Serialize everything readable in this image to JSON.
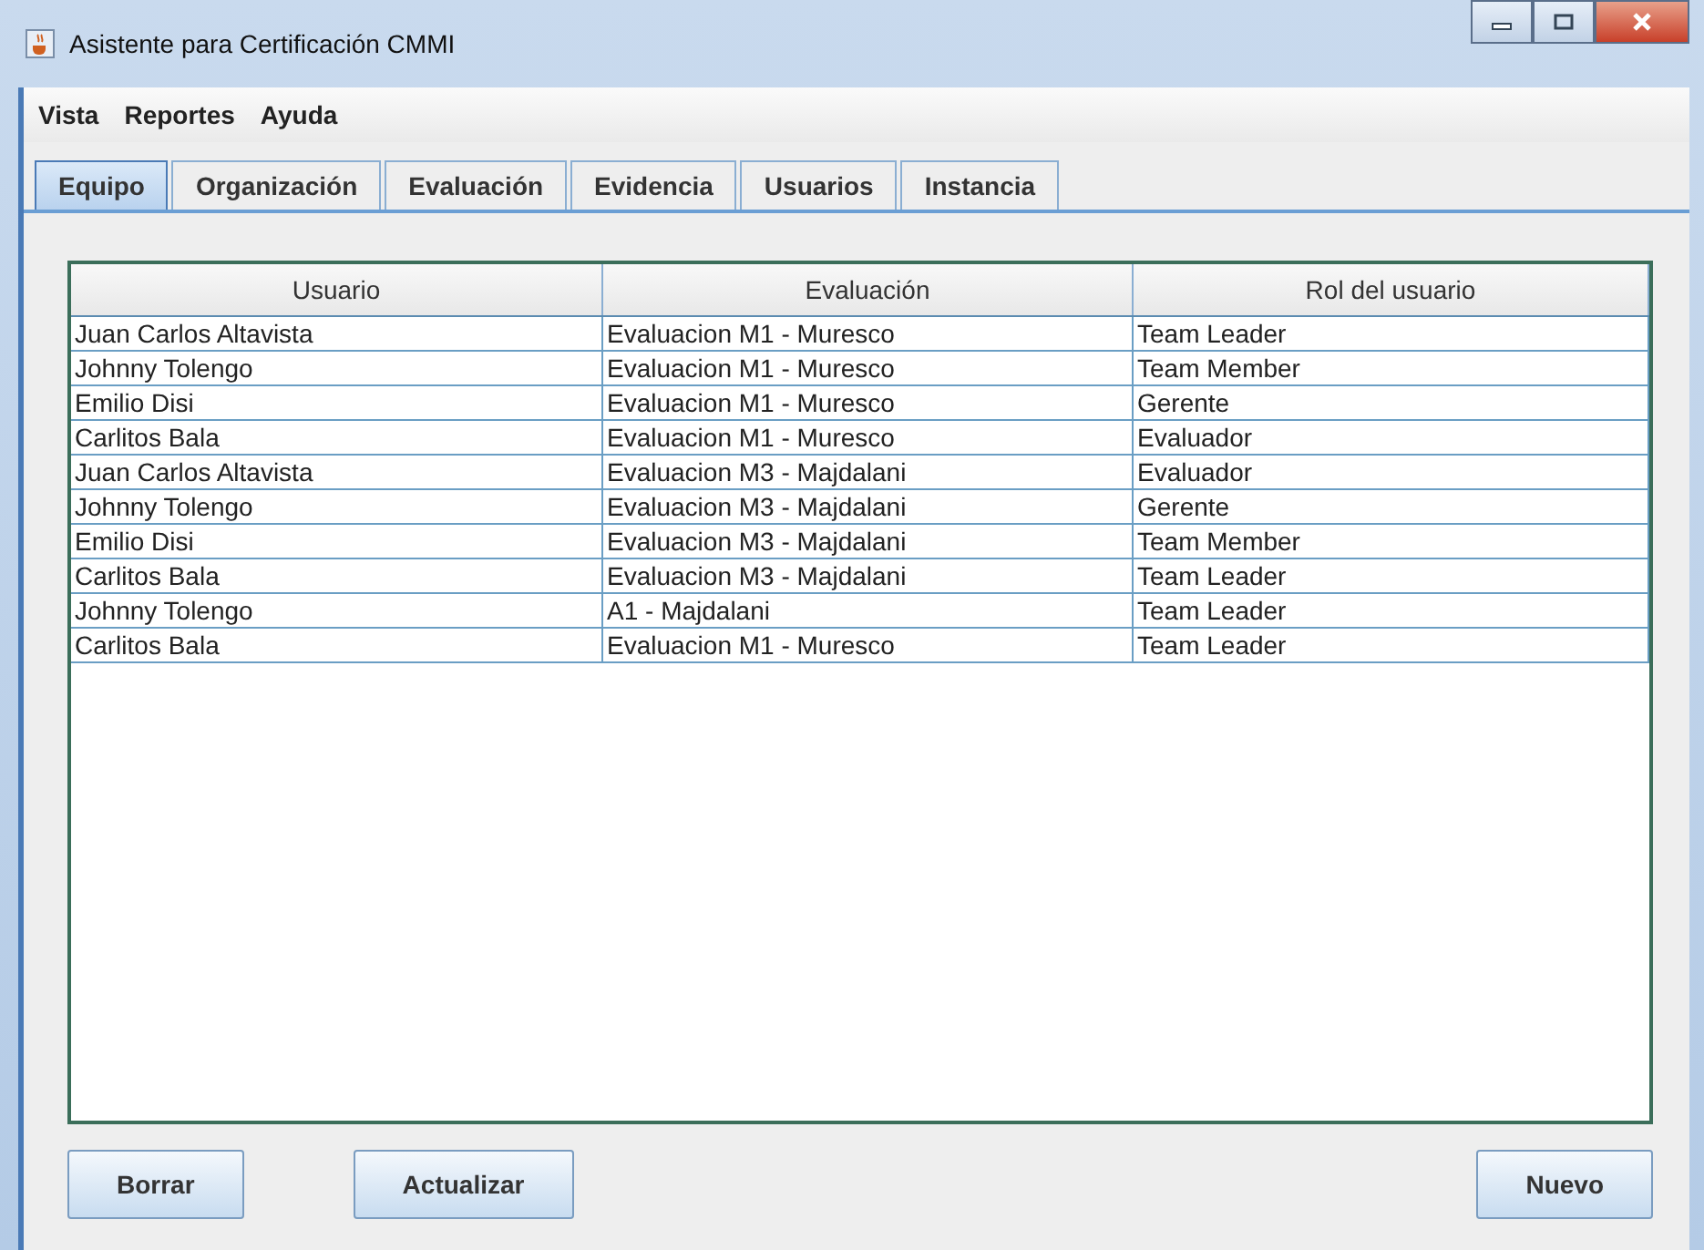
{
  "window": {
    "title": "Asistente para Certificación CMMI"
  },
  "menu": [
    "Vista",
    "Reportes",
    "Ayuda"
  ],
  "tabs": [
    {
      "label": "Equipo",
      "selected": true
    },
    {
      "label": "Organización",
      "selected": false
    },
    {
      "label": "Evaluación",
      "selected": false
    },
    {
      "label": "Evidencia",
      "selected": false
    },
    {
      "label": "Usuarios",
      "selected": false
    },
    {
      "label": "Instancia",
      "selected": false
    }
  ],
  "table": {
    "columns": [
      "Usuario",
      "Evaluación",
      "Rol del usuario"
    ],
    "rows": [
      [
        "Juan Carlos Altavista",
        "Evaluacion M1 - Muresco",
        "Team Leader"
      ],
      [
        "Johnny Tolengo",
        "Evaluacion M1 - Muresco",
        "Team Member"
      ],
      [
        "Emilio Disi",
        "Evaluacion M1 - Muresco",
        "Gerente"
      ],
      [
        "Carlitos Bala",
        "Evaluacion M1 - Muresco",
        "Evaluador"
      ],
      [
        "Juan Carlos Altavista",
        "Evaluacion M3 - Majdalani",
        "Evaluador"
      ],
      [
        "Johnny Tolengo",
        "Evaluacion M3 - Majdalani",
        "Gerente"
      ],
      [
        "Emilio Disi",
        "Evaluacion M3 - Majdalani",
        "Team Member"
      ],
      [
        "Carlitos Bala",
        "Evaluacion M3 - Majdalani",
        "Team Leader"
      ],
      [
        "Johnny Tolengo",
        "A1 - Majdalani",
        "Team Leader"
      ],
      [
        "Carlitos Bala",
        "Evaluacion M1 - Muresco",
        "Team Leader"
      ]
    ]
  },
  "buttons": {
    "left": [
      "Borrar",
      "Actualizar"
    ],
    "right": [
      "Nuevo"
    ]
  }
}
